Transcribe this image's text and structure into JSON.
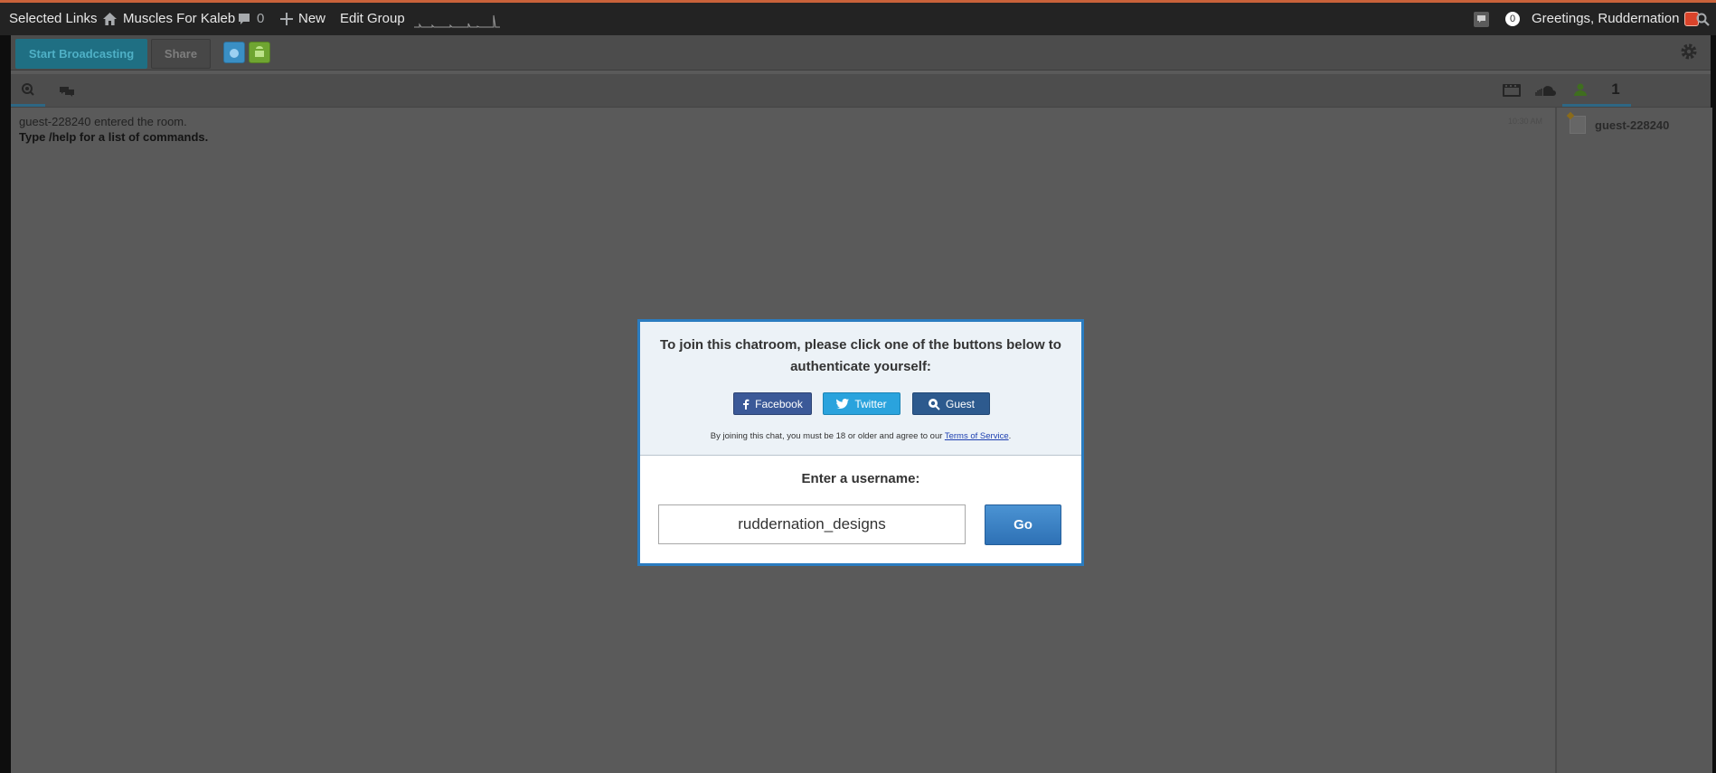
{
  "adminbar": {
    "selected_links": "Selected Links",
    "site_name": "Muscles For Kaleb",
    "comments_count": "0",
    "new_label": "New",
    "edit_group": "Edit Group",
    "notifications_count": "0",
    "greeting": "Greetings, Ruddernation"
  },
  "toolbar": {
    "start_broadcasting": "Start Broadcasting",
    "share": "Share"
  },
  "userlist_tab": {
    "count": "1"
  },
  "chat": {
    "messages": [
      {
        "text": "guest-228240 entered the room.",
        "time": "10:30 AM"
      },
      {
        "text": "Type /help for a list of commands."
      }
    ]
  },
  "users": [
    {
      "name": "guest-228240"
    }
  ],
  "modal": {
    "join_prompt": "To join this chatroom, please click one of the buttons below to authenticate yourself:",
    "facebook": "Facebook",
    "twitter": "Twitter",
    "guest": "Guest",
    "tos_prefix": "By joining this chat, you must be 18 or older and agree to our ",
    "tos_link": "Terms of Service",
    "tos_suffix": ".",
    "enter_username": "Enter a username:",
    "username_value": "ruddernation_designs",
    "go": "Go"
  },
  "colors": {
    "accent_line": "#c9623a",
    "modal_border": "#2a7cc0",
    "facebook": "#3b5998",
    "twitter": "#2aa3dd",
    "guest": "#2d5a8e"
  }
}
